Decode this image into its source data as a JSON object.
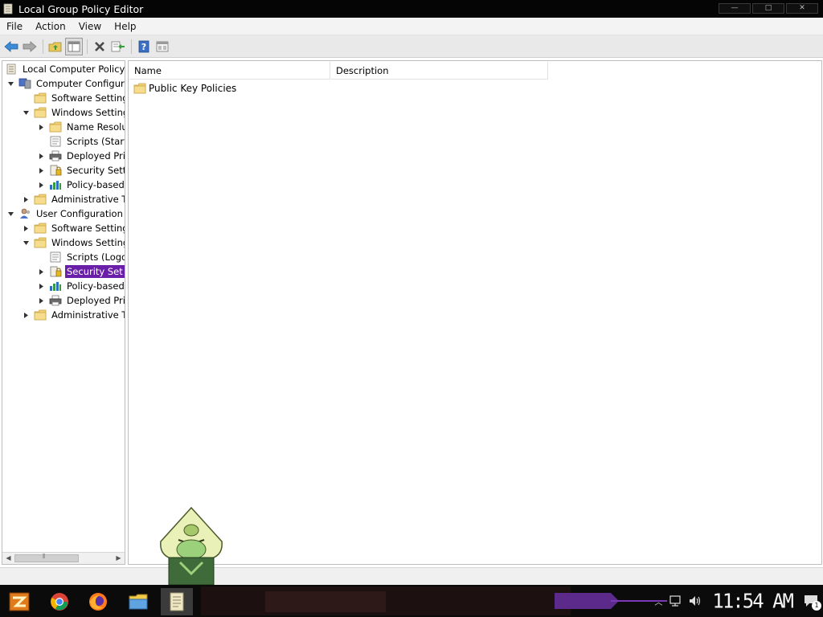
{
  "window": {
    "title": "Local Group Policy Editor",
    "buttons": {
      "minimize": "—",
      "maximize": "□",
      "close": "✕"
    }
  },
  "menu": {
    "items": [
      "File",
      "Action",
      "View",
      "Help"
    ]
  },
  "toolbar": {
    "buttons": [
      "back-icon",
      "forward-icon",
      "up-folder-icon",
      "show-hide-console-tree-icon",
      "delete-icon",
      "export-list-icon",
      "help-icon",
      "properties-icon"
    ]
  },
  "tree": {
    "rows": [
      {
        "label": "Local Computer Policy",
        "icon": "policy-icon",
        "expander": "none"
      },
      {
        "label": "Computer Configurati",
        "icon": "computer-icon",
        "expander": "expanded"
      },
      {
        "label": "Software Setting",
        "icon": "folder-icon",
        "expander": "none"
      },
      {
        "label": "Windows Setting:",
        "icon": "folder-icon",
        "expander": "expanded"
      },
      {
        "label": "Name Resoluti",
        "icon": "folder-icon",
        "expander": "collapsed"
      },
      {
        "label": "Scripts (Start",
        "icon": "scripts-icon",
        "expander": "none"
      },
      {
        "label": "Deployed Prin",
        "icon": "printer-icon",
        "expander": "collapsed"
      },
      {
        "label": "Security Sett",
        "icon": "security-icon",
        "expander": "collapsed"
      },
      {
        "label": "Policy-based (",
        "icon": "chart-icon",
        "expander": "collapsed"
      },
      {
        "label": "Administrative Te",
        "icon": "folder-icon",
        "expander": "collapsed"
      },
      {
        "label": "User Configuration",
        "icon": "user-icon",
        "expander": "expanded"
      },
      {
        "label": "Software Setting",
        "icon": "folder-icon",
        "expander": "collapsed"
      },
      {
        "label": "Windows Setting:",
        "icon": "folder-icon",
        "expander": "expanded"
      },
      {
        "label": "Scripts (Logor",
        "icon": "scripts-icon",
        "expander": "none"
      },
      {
        "label": "Security Set",
        "icon": "security-icon",
        "expander": "collapsed",
        "selected": true
      },
      {
        "label": "Policy-based (",
        "icon": "chart-icon",
        "expander": "collapsed"
      },
      {
        "label": "Deployed Prin",
        "icon": "printer-icon",
        "expander": "collapsed"
      },
      {
        "label": "Administrative Te",
        "icon": "folder-icon",
        "expander": "collapsed"
      }
    ]
  },
  "list": {
    "columns": {
      "name": "Name",
      "description": "Description"
    },
    "items": [
      {
        "name": "Public Key Policies",
        "icon": "folder-icon"
      }
    ]
  },
  "taskbar": {
    "apps": [
      "start-icon",
      "chrome-icon",
      "firefox-icon",
      "file-explorer-icon",
      "group-policy-editor-icon"
    ],
    "clock": "11:54 AM",
    "notification_count": "1",
    "colors": {
      "accent": "#6a1fa8",
      "selection": "#6a1fa8"
    }
  }
}
